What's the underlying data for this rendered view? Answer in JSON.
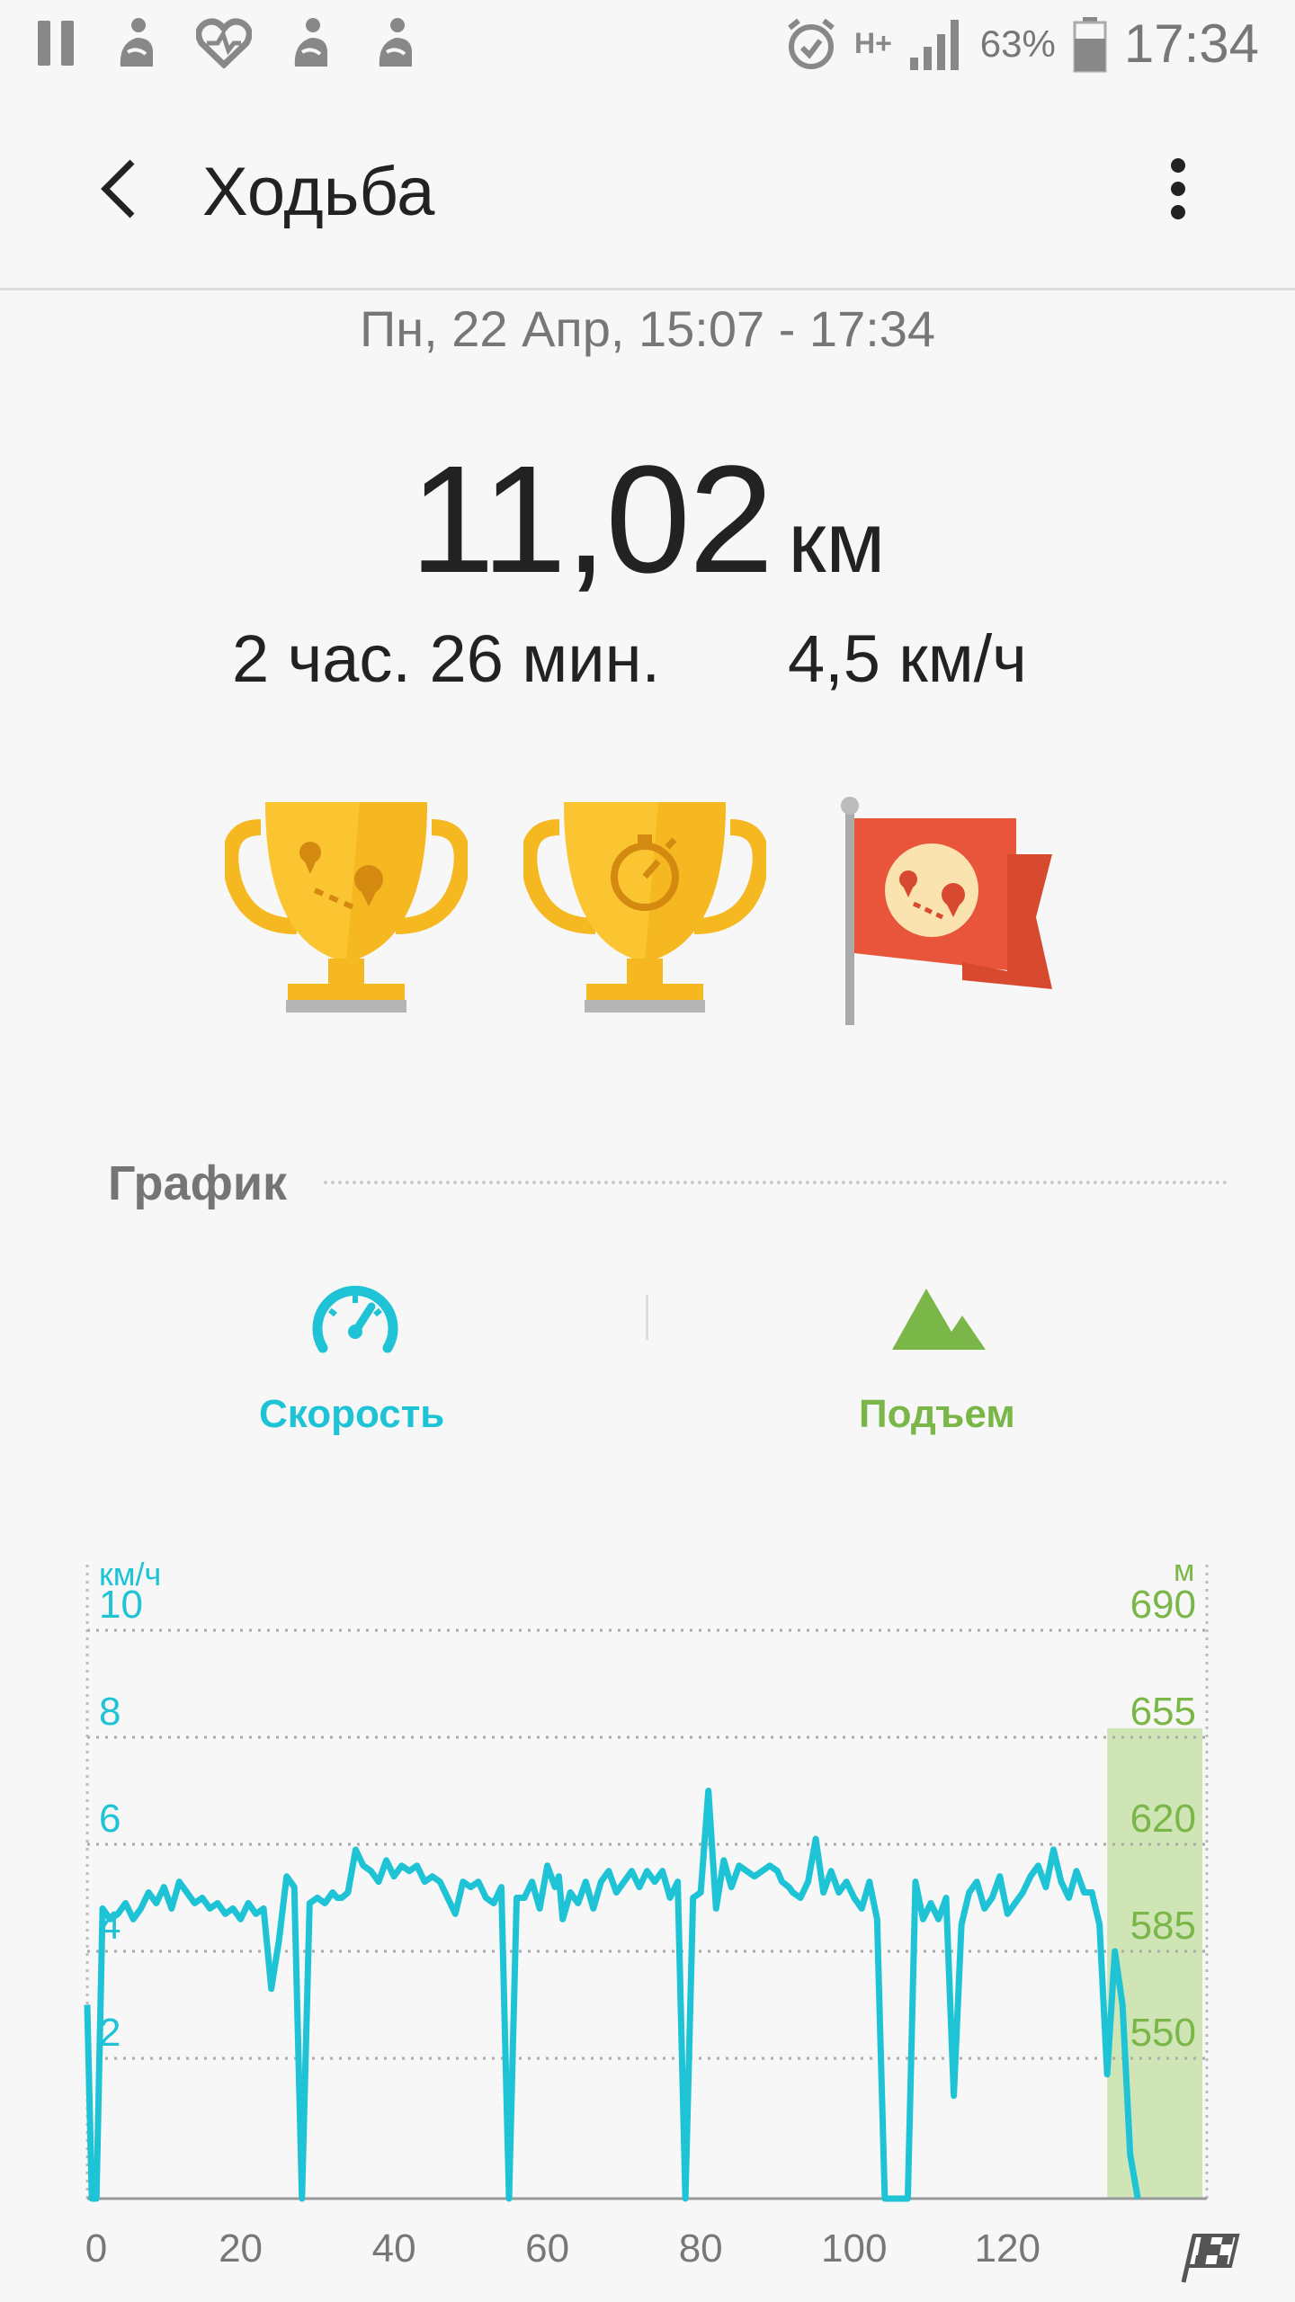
{
  "status_bar": {
    "battery_percent": "63%",
    "time": "17:34",
    "network": "H+"
  },
  "header": {
    "title": "Ходьба"
  },
  "summary": {
    "date_range": "Пн, 22 Апр, 15:07 - 17:34",
    "distance_value": "11,02",
    "distance_unit": "км",
    "duration": "2 час. 26 мин.",
    "avg_speed": "4,5 км/ч"
  },
  "achievements": [
    {
      "name": "distance-trophy-icon"
    },
    {
      "name": "time-trophy-icon"
    },
    {
      "name": "route-flag-icon"
    }
  ],
  "graph": {
    "section_title": "График",
    "tabs": [
      {
        "label": "Скорость",
        "color": "#1ec3d6"
      },
      {
        "label": "Подъем",
        "color": "#7ab648"
      }
    ]
  },
  "chart_data": {
    "type": "line",
    "left_axis_label": "км/ч",
    "right_axis_label": "м",
    "left_ticks": [
      "2",
      "4",
      "6",
      "8",
      "10"
    ],
    "right_ticks": [
      "550",
      "585",
      "620",
      "655",
      "690"
    ],
    "x_ticks": [
      "0",
      "20",
      "40",
      "60",
      "80",
      "100",
      "120"
    ],
    "xlim": [
      0,
      146
    ],
    "ylim": [
      0,
      10
    ],
    "speed_color": "#1ec3d6",
    "elevation_color": "#cfe5b6",
    "speed_series": {
      "x": [
        0,
        0.6,
        1.2,
        2,
        3,
        4,
        5,
        6,
        7,
        8,
        9,
        10,
        11,
        12,
        13,
        14,
        15,
        16,
        17,
        18,
        19,
        20,
        21,
        22,
        23,
        24,
        25,
        26,
        27,
        28,
        29,
        30,
        31,
        32,
        32.6,
        33.2,
        34,
        35,
        36,
        37,
        38,
        39,
        40,
        41,
        42,
        43,
        44,
        45,
        46,
        47,
        48,
        49,
        50,
        51,
        52,
        53,
        54,
        55,
        56,
        57,
        58,
        59,
        60,
        61,
        61.5,
        62,
        63,
        64,
        65,
        66,
        67,
        68,
        69,
        70,
        71,
        72,
        73,
        74,
        75,
        76,
        77,
        78,
        79,
        80,
        81,
        82,
        83,
        84,
        85,
        86,
        87,
        88,
        89,
        90,
        90.6,
        91.5,
        92,
        93,
        94,
        95,
        96,
        97,
        98,
        99,
        100,
        101,
        102,
        103,
        104,
        105,
        106,
        107,
        108,
        109,
        110,
        111,
        112,
        113,
        114,
        115,
        116,
        117,
        118,
        119,
        120,
        121,
        122,
        123,
        124,
        125,
        126,
        127,
        128,
        129,
        130,
        131,
        132,
        133,
        134,
        135,
        136,
        137,
        138,
        139,
        140,
        141,
        142,
        143,
        144,
        145,
        145.6
      ],
      "y": [
        3.0,
        0.0,
        0.0,
        4.8,
        4.6,
        4.7,
        4.9,
        4.6,
        4.8,
        5.1,
        4.9,
        5.2,
        4.8,
        5.3,
        5.1,
        4.9,
        5.0,
        4.8,
        4.9,
        4.7,
        4.8,
        4.6,
        4.9,
        4.7,
        4.8,
        3.3,
        4.2,
        5.4,
        5.2,
        0.0,
        4.9,
        5.0,
        4.9,
        5.1,
        5.0,
        5.0,
        5.1,
        5.9,
        5.6,
        5.5,
        5.3,
        5.7,
        5.4,
        5.6,
        5.5,
        5.6,
        5.3,
        5.4,
        5.3,
        5.0,
        4.7,
        5.3,
        5.2,
        5.3,
        5.0,
        4.9,
        5.2,
        0.0,
        5.0,
        5.0,
        5.3,
        4.8,
        5.6,
        5.2,
        5.4,
        4.6,
        5.1,
        4.9,
        5.3,
        4.8,
        5.3,
        5.5,
        5.1,
        5.3,
        5.5,
        5.2,
        5.5,
        5.3,
        5.5,
        5.0,
        5.3,
        0.0,
        5.0,
        5.1,
        7.0,
        4.8,
        5.7,
        5.2,
        5.6,
        5.5,
        5.4,
        5.5,
        5.6,
        5.5,
        5.3,
        5.2,
        5.1,
        5.0,
        5.3,
        6.1,
        5.1,
        5.5,
        5.1,
        5.3,
        5.0,
        4.8,
        5.3,
        4.6,
        0.0,
        0.0,
        0.0,
        0.0,
        5.3,
        4.6,
        4.9,
        4.6,
        5.0,
        1.3,
        4.5,
        5.1,
        5.3,
        4.8,
        5.0,
        5.4,
        4.7,
        4.9,
        5.1,
        5.4,
        5.6,
        5.2,
        5.9,
        5.3,
        5.0,
        5.5,
        5.1,
        5.1,
        4.5,
        1.7,
        4.0,
        3.0,
        0.2,
        0.0
      ]
    },
    "elevation_highlight": {
      "x_start": 133,
      "x_end": 146,
      "top_value": "655"
    }
  }
}
